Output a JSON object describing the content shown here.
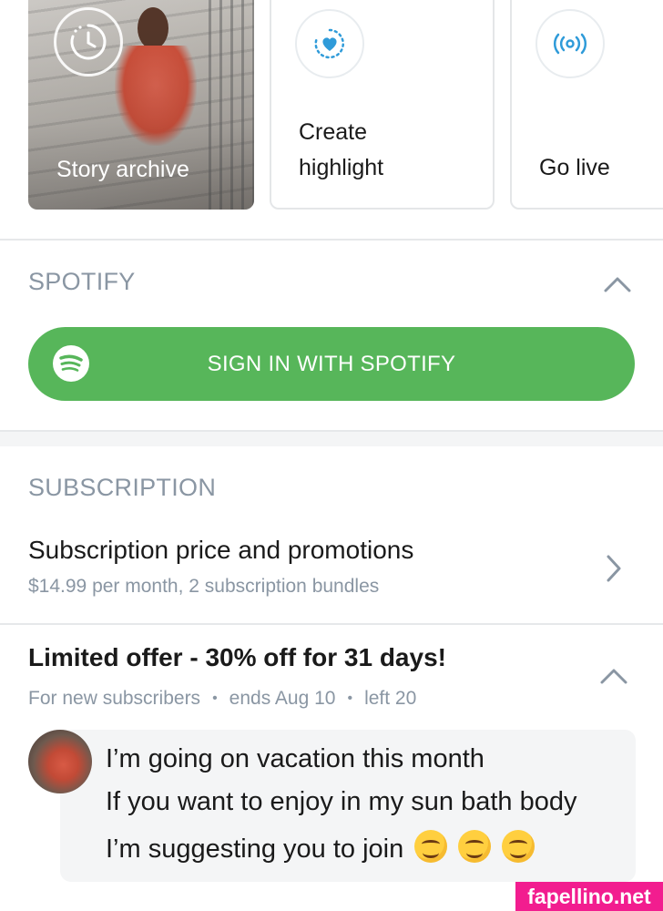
{
  "cards": {
    "archive_label": "Story archive",
    "highlight_label": "Create highlight",
    "live_label": "Go live"
  },
  "spotify": {
    "section_title": "SPOTIFY",
    "button_label": "SIGN IN WITH SPOTIFY",
    "brand_color": "#57b65a"
  },
  "subscription": {
    "section_title": "SUBSCRIPTION",
    "row_title": "Subscription price and promotions",
    "row_subtitle": "$14.99 per month, 2 subscription bundles"
  },
  "offer": {
    "title": "Limited offer - 30% off for 31 days!",
    "meta": [
      "For new subscribers",
      "ends Aug 10",
      "left 20"
    ],
    "message_lines": [
      "I’m going on vacation this month",
      "If you want to enjoy in my sun bath body",
      "I’m suggesting you to join"
    ],
    "emoji": [
      "yum-emoji",
      "yum-emoji",
      "yum-emoji"
    ]
  },
  "watermark": "fapellino.net",
  "colors": {
    "accent_blue": "#2f9bd9",
    "muted_text": "#8a96a3",
    "watermark_pink": "#f21d8f"
  }
}
